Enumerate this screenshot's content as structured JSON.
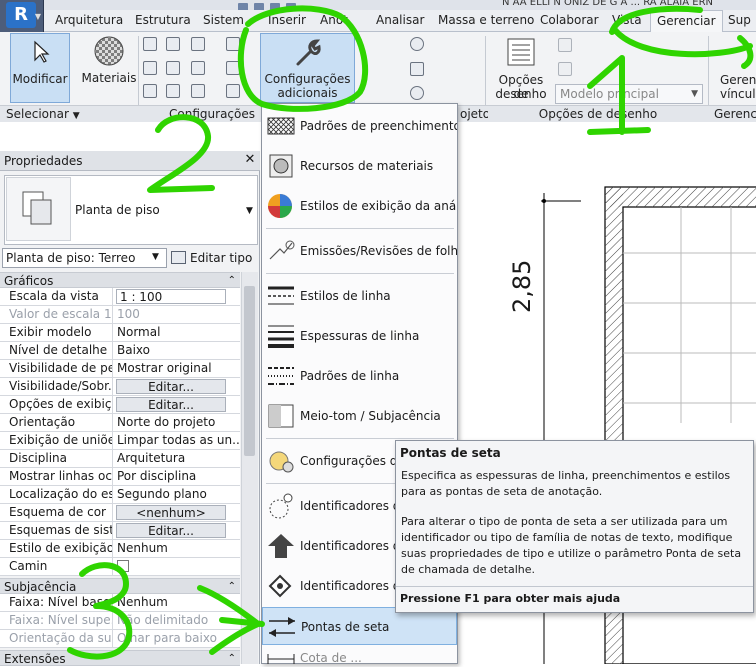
{
  "window": {
    "title": "N AA ELLI N ONIZ DE G A ... RA ALAIA ERN"
  },
  "ribbon": {
    "tabs": [
      "Arquitetura",
      "Estrutura",
      "Sistem",
      "Inserir",
      "Anot",
      "Analisar",
      "Massa e terreno",
      "Colaborar",
      "Vista",
      "Gerenciar",
      "Sup"
    ],
    "active_tab": "Gerenciar",
    "modificar_label": "Modificar",
    "materiais_label": "Materiais",
    "config_label_1": "Configurações",
    "config_label_2": "adicionais",
    "opcoes_desenho_1": "Opções de",
    "opcoes_desenho_2": "desenho",
    "modelo_combo": "Modelo principal",
    "gerenc_1": "Gerenc",
    "gerenc_2": "vínculo",
    "panels": {
      "selecionar": "Selecionar",
      "configuracoes": "Configurações",
      "projeto": "ojeto",
      "opcoes_desenho": "Opções de desenho",
      "gerencia": "Gerencia"
    }
  },
  "menu": {
    "items": [
      {
        "label": "Padrões de preenchimento",
        "icon": "fill-pattern-icon"
      },
      {
        "label": "Recursos de materiais",
        "icon": "material-assets-icon"
      },
      {
        "label": "Estilos de exibição da análise",
        "icon": "analysis-display-icon"
      },
      {
        "label": "Emissões/Revisões de folhas",
        "icon": "sheet-issues-icon"
      },
      {
        "label": "Estilos de linha",
        "icon": "line-styles-icon"
      },
      {
        "label": "Espessuras de linha",
        "icon": "line-weights-icon"
      },
      {
        "label": "Padrões de linha",
        "icon": "line-patterns-icon"
      },
      {
        "label": "Meio-tom / Subjacência",
        "icon": "halftone-icon"
      },
      {
        "label": "Configurações do",
        "icon": "detail-settings-icon"
      },
      {
        "label": "Identificadores de",
        "icon": "tag-icon"
      },
      {
        "label": "Identificadores de",
        "icon": "tag-arrow-icon"
      },
      {
        "label": "Identificadores de",
        "icon": "tag-diamond-icon"
      },
      {
        "label": "Pontas de seta",
        "icon": "arrowheads-icon"
      },
      {
        "label": "Cota de ...",
        "icon": "dimension-icon"
      }
    ],
    "highlighted": "Pontas de seta"
  },
  "tooltip": {
    "title": "Pontas de seta",
    "description": "Especifica as espessuras de linha, preenchimentos e estilos para as pontas de seta de anotação.",
    "detail": "Para alterar o tipo de ponta de seta a ser utilizada para um identificador ou tipo de família de notas de texto, modifique suas propriedades de tipo e utilize o parâmetro Ponta de seta de chamada de detalhe.",
    "help": "Pressione F1 para obter mais ajuda"
  },
  "properties": {
    "title": "Propriedades",
    "type_name": "Planta de piso",
    "instance_selector": "Planta de piso: Terreo",
    "edit_type": "Editar tipo",
    "group_graficos": "Gráficos",
    "group_subjacencia": "Subjacência",
    "group_extensoes": "Extensões",
    "rows": [
      {
        "k": "Escala da vista",
        "v": "1 : 100"
      },
      {
        "k": "Valor de escala    1:",
        "v": "100"
      },
      {
        "k": "Exibir modelo",
        "v": "Normal"
      },
      {
        "k": "Nível de detalhe",
        "v": "Baixo"
      },
      {
        "k": "Visibilidade de pe...",
        "v": "Mostrar original"
      },
      {
        "k": "Visibilidade/Sobr...",
        "v": "Editar..."
      },
      {
        "k": "Opções de exibiç...",
        "v": "Editar..."
      },
      {
        "k": "Orientação",
        "v": "Norte do projeto"
      },
      {
        "k": "Exibição de uniõe...",
        "v": "Limpar todas as un..."
      },
      {
        "k": "Disciplina",
        "v": "Arquitetura"
      },
      {
        "k": "Mostrar linhas oc...",
        "v": "Por disciplina"
      },
      {
        "k": "Localização do es...",
        "v": "Segundo plano"
      },
      {
        "k": "Esquema de cor",
        "v": "<nenhum>"
      },
      {
        "k": "Esquemas de sist...",
        "v": "Editar..."
      },
      {
        "k": "Estilo de exibição ...",
        "v": "Nenhum"
      },
      {
        "k": "Camin",
        "v": ""
      }
    ],
    "sub_rows": [
      {
        "k": "Faixa: Nível base",
        "v": "Nenhum"
      },
      {
        "k": "Faixa: Nível supe...",
        "v": "Não delimitado"
      },
      {
        "k": "Orientação da su...",
        "v": "Olhar para baixo"
      }
    ]
  },
  "canvas": {
    "dimension": "2,85"
  },
  "annotations": [
    "1",
    "2",
    "3"
  ],
  "colors": {
    "annotation": "#2fd400",
    "highlight": "#cfe3f6",
    "ribbon_button_active": "#c9dff4"
  }
}
